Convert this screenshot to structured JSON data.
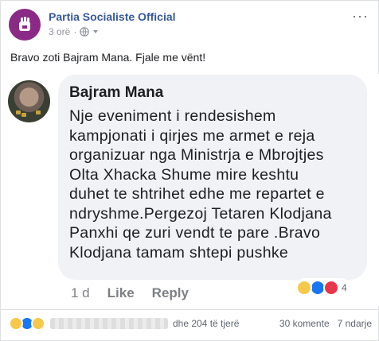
{
  "post": {
    "page_name": "Partia Socialiste Official",
    "time": "3 orë",
    "separator": "·",
    "text": "Bravo zoti Bajram Mana. Fjale me vënt!"
  },
  "comment": {
    "author": "Bajram Mana",
    "text": "Nje eveniment i rendesishem\nkampjonati i qirjes me armet e reja\norganizuar nga Ministrja e Mbrojtjes\nOlta Xhacka Shume mire keshtu\nduhet te shtrihet edhe me repartet e\nndryshme.Pergezoj Tetaren Klodjana\nPanxhi qe zuri vendt te pare .Bravo\nKlodjana tamam shtepi pushke",
    "time": "1 d",
    "like_label": "Like",
    "reply_label": "Reply",
    "reaction_count": "4"
  },
  "footer": {
    "others": "dhe 204 të tjerë",
    "comments": "30 komente",
    "shares": "7 ndarje"
  },
  "colors": {
    "page_name": "#365899",
    "brand_purple": "#8a2a86",
    "like_blue": "#1877f2"
  }
}
